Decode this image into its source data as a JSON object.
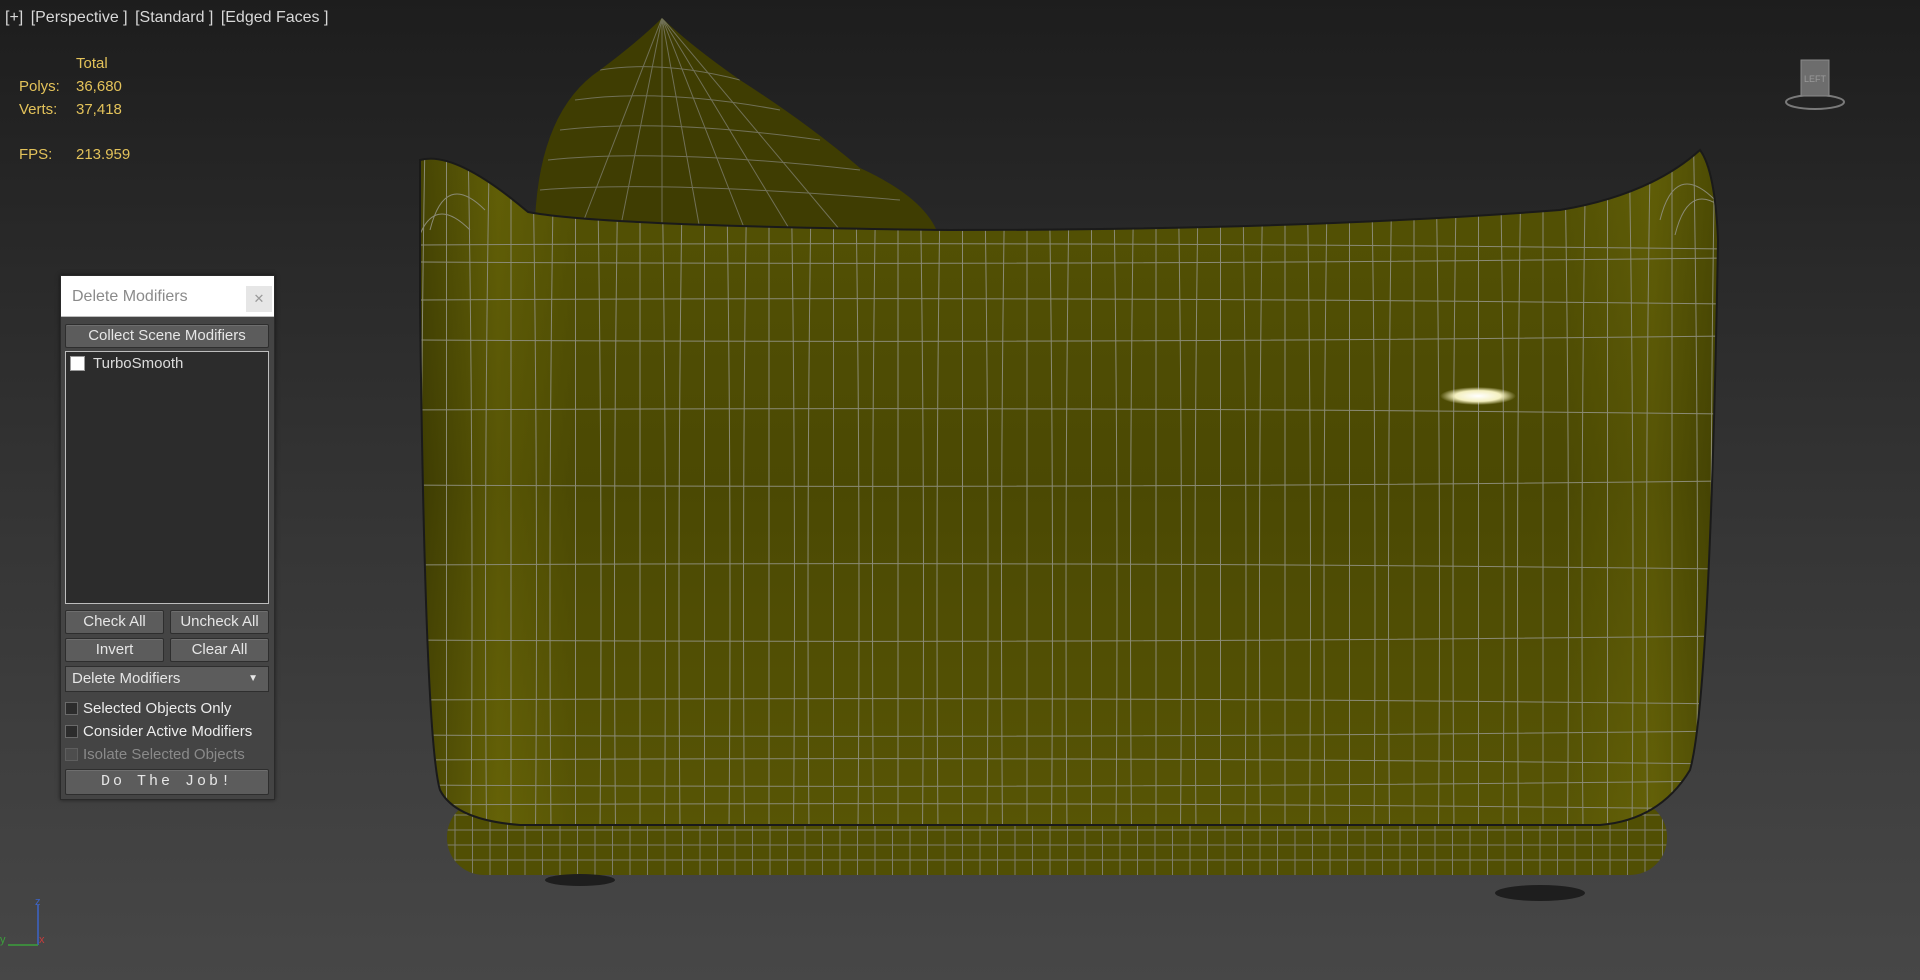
{
  "viewport": {
    "plus_label": "[+]",
    "view_label": "[Perspective ]",
    "shading_label": "[Standard ]",
    "edges_label": "[Edged Faces ]"
  },
  "stats": {
    "header": "Total",
    "polys_label": "Polys:",
    "polys_value": "36,680",
    "verts_label": "Verts:",
    "verts_value": "37,418",
    "fps_label": "FPS:",
    "fps_value": "213.959"
  },
  "viewcube": {
    "face_label": "LEFT"
  },
  "axis": {
    "z": "z",
    "y": "y",
    "x": "x"
  },
  "dialog": {
    "title": "Delete Modifiers",
    "close_icon": "close-icon",
    "collect_button": "Collect Scene Modifiers",
    "modifiers": [
      {
        "label": "TurboSmooth",
        "checked": false
      }
    ],
    "check_all": "Check All",
    "uncheck_all": "Uncheck All",
    "invert": "Invert",
    "clear_all": "Clear All",
    "action_select": "Delete Modifiers",
    "selected_only": "Selected Objects Only",
    "consider_active": "Consider Active Modifiers",
    "isolate_selected": "Isolate Selected Objects",
    "do_job": "Do The Job!"
  },
  "colors": {
    "model_fill": "#4c4a02",
    "wire": "#8c8c78",
    "stats_text": "#e3c25a"
  }
}
